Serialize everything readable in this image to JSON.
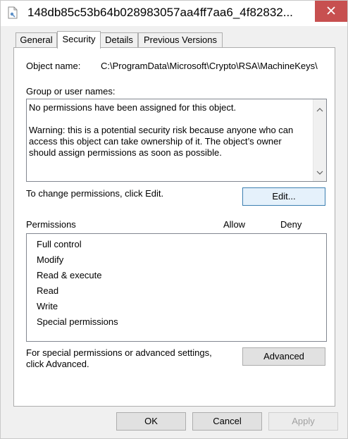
{
  "window": {
    "title": "148db85c53b64b028983057aa4ff7aa6_4f82832..."
  },
  "tabs": [
    {
      "label": "General"
    },
    {
      "label": "Security"
    },
    {
      "label": "Details"
    },
    {
      "label": "Previous Versions"
    }
  ],
  "security": {
    "object_name_label": "Object name:",
    "object_name_value": "C:\\ProgramData\\Microsoft\\Crypto\\RSA\\MachineKeys\\",
    "group_label": "Group or user names:",
    "group_message_1": "No permissions have been assigned for this object.",
    "group_warning_line1": "Warning: this is a potential security risk because anyone who can",
    "group_warning_line2": "access this object can take ownership of it. The object’s owner",
    "group_warning_line3": "should assign permissions as soon as possible.",
    "change_hint": "To change permissions, click Edit.",
    "edit_label": "Edit...",
    "permissions_label": "Permissions",
    "allow_label": "Allow",
    "deny_label": "Deny",
    "permissions": [
      {
        "label": "Full control"
      },
      {
        "label": "Modify"
      },
      {
        "label": "Read & execute"
      },
      {
        "label": "Read"
      },
      {
        "label": "Write"
      },
      {
        "label": "Special permissions"
      }
    ],
    "advanced_hint_line1": "For special permissions or advanced settings,",
    "advanced_hint_line2": "click Advanced.",
    "advanced_label": "Advanced"
  },
  "footer": {
    "ok_label": "OK",
    "cancel_label": "Cancel",
    "apply_label": "Apply"
  },
  "colors": {
    "close_button": "#c75050",
    "disabled_text": "#a0a0a0"
  }
}
